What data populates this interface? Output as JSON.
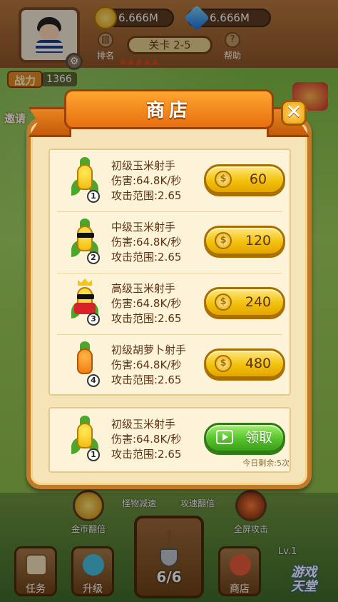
{
  "hud": {
    "gold_amount": "6.666M",
    "gem_amount": "6.666M",
    "rank_label": "排名",
    "help_label": "帮助",
    "level_label": "关卡 2-5",
    "power_label": "战力",
    "power_value": "1366",
    "invite_label": "邀请"
  },
  "shop": {
    "title": "商店",
    "close_symbol": "✕",
    "items": [
      {
        "name": "初级玉米射手",
        "damage": "伤害:64.8K/秒",
        "range": "攻击范围:2.65",
        "price": "60",
        "rank": "1",
        "character": "corn"
      },
      {
        "name": "中级玉米射手",
        "damage": "伤害:64.8K/秒",
        "range": "攻击范围:2.65",
        "price": "120",
        "rank": "2",
        "character": "corn-sunglasses"
      },
      {
        "name": "高级玉米射手",
        "damage": "伤害:64.8K/秒",
        "range": "攻击范围:2.65",
        "price": "240",
        "rank": "3",
        "character": "corn-crown"
      },
      {
        "name": "初级胡萝卜射手",
        "damage": "伤害:64.8K/秒",
        "range": "攻击范围:2.65",
        "price": "480",
        "rank": "4",
        "character": "carrot"
      }
    ],
    "free_item": {
      "name": "初级玉米射手",
      "damage": "伤害:64.8K/秒",
      "range": "攻击范围:2.65",
      "rank": "1",
      "claim_label": "领取",
      "remaining": "今日剩余:5次"
    },
    "coin_symbol": "$"
  },
  "skills": {
    "gold_double": "金币翻倍",
    "monster_slow": "怪物减速",
    "attack_speed": "攻速翻倍",
    "full_screen": "全屏攻击"
  },
  "nav": {
    "task": "任务",
    "upgrade": "升级",
    "shop": "商店",
    "shovel_count": "6/6",
    "level_badge": "Lv.1"
  },
  "watermark": "游戏\n天堂",
  "colors": {
    "price_button": "#f2c20c",
    "claim_button": "#55c22c",
    "ribbon": "#e76f0f",
    "panel": "#f6e4b9"
  }
}
